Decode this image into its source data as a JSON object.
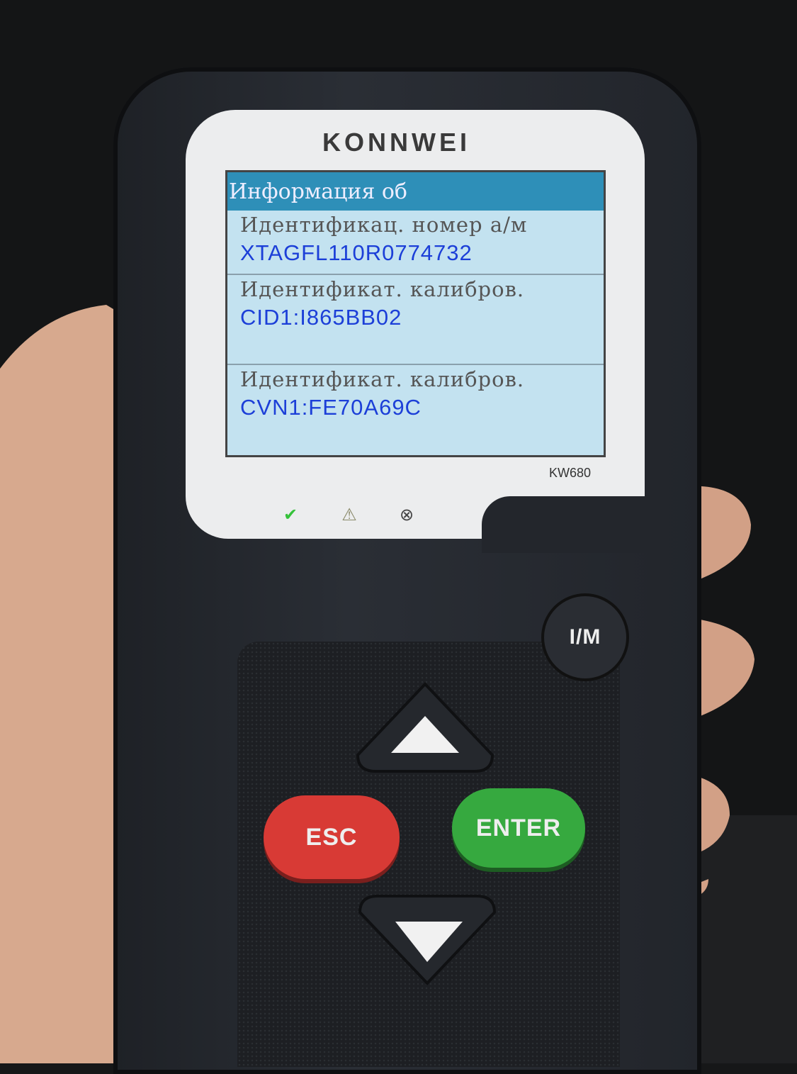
{
  "device": {
    "brand": "KONNWEI",
    "model": "KW680",
    "leds": [
      {
        "icon": "check-circle-icon",
        "color": "#35c23a"
      },
      {
        "icon": "warning-triangle-icon",
        "color": "#8a8a6a"
      },
      {
        "icon": "x-circle-icon",
        "color": "#444444"
      }
    ]
  },
  "screen": {
    "title": "Информация об",
    "rows": [
      {
        "label": "Идентификац. номер а/м",
        "value": "XTAGFL110R0774732"
      },
      {
        "label": "Идентификат. калибров.",
        "value": "CID1:I865BB02"
      },
      {
        "label": "Идентификат. калибров.",
        "value": "CVN1:FE70A69C"
      }
    ]
  },
  "buttons": {
    "im": "I/M",
    "esc": "ESC",
    "enter": "ENTER",
    "up": "up-arrow-icon",
    "down": "down-arrow-icon"
  },
  "colors": {
    "esc": "#d83a35",
    "enter": "#36a93f",
    "header": "#2e8fb8",
    "value_text": "#1c3fd8"
  }
}
